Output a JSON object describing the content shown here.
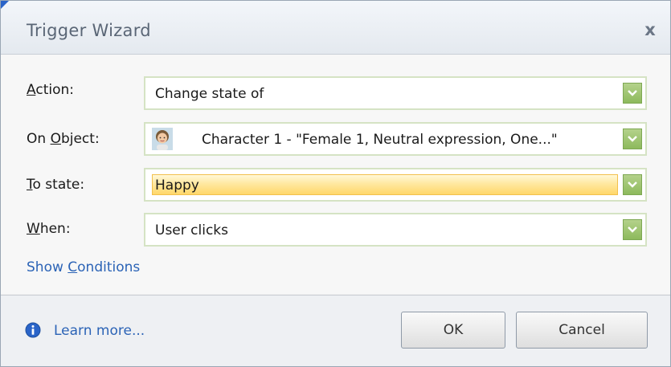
{
  "window": {
    "title": "Trigger Wizard",
    "close_label": "x"
  },
  "form": {
    "action": {
      "label": "Action:",
      "mnemonic": "A",
      "label_rest": "ction:",
      "value": "Change state of"
    },
    "on_object": {
      "label": "On Object:",
      "label_pre": "On ",
      "mnemonic": "O",
      "label_rest": "bject:",
      "value": "Character 1 - \"Female 1, Neutral expression, One...\"",
      "icon": "character-avatar-icon"
    },
    "to_state": {
      "label": "To state:",
      "mnemonic": "T",
      "label_rest": "o state:",
      "value": "Happy"
    },
    "when": {
      "label": "When:",
      "mnemonic": "W",
      "label_rest": "hen:",
      "value": "User clicks"
    }
  },
  "links": {
    "show_conditions": {
      "label": "Show Conditions",
      "pre": "Show ",
      "mnemonic": "C",
      "rest": "onditions"
    },
    "learn_more": "Learn more..."
  },
  "buttons": {
    "ok": "OK",
    "cancel": "Cancel"
  },
  "colors": {
    "combo_button": "#8dba5c",
    "link": "#2b63b6",
    "highlight": "#ffd76a",
    "info_icon": "#2a64c8"
  }
}
